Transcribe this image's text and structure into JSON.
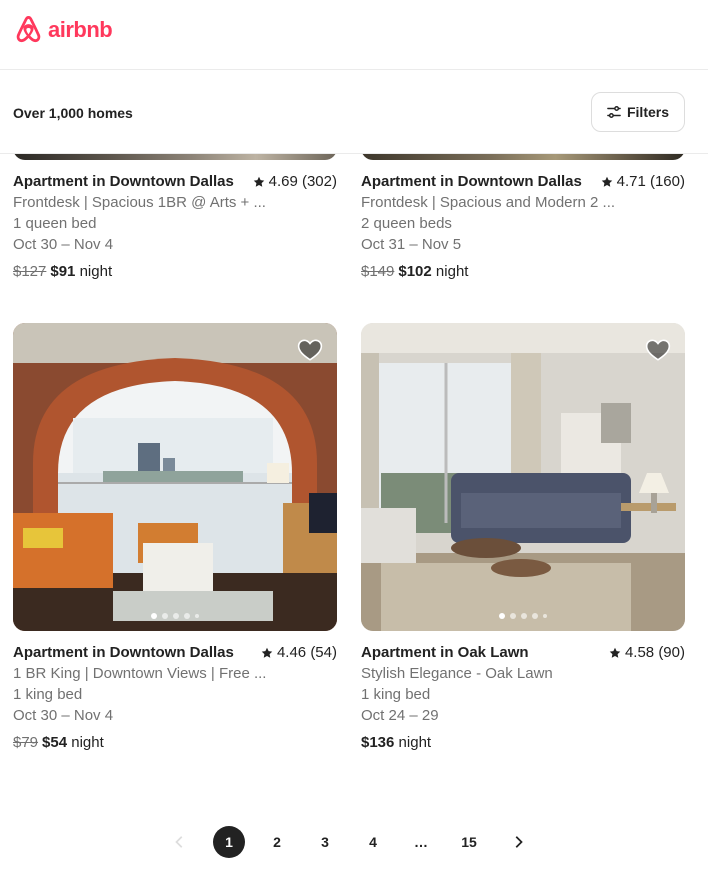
{
  "brand": {
    "name": "airbnb",
    "color": "#ff385c",
    "logo_icon": "airbnb-belo-icon"
  },
  "results": {
    "count_label": "Over 1,000 homes"
  },
  "filters": {
    "label": "Filters",
    "icon": "sliders-icon"
  },
  "listings": [
    {
      "title": "Apartment in Downtown Dallas",
      "rating": "4.69 (302)",
      "description": "Frontdesk | Spacious 1BR @ Arts + ...",
      "beds": "1 queen bed",
      "dates": "Oct 30 – Nov 4",
      "original_price": "$127",
      "price": "$91",
      "price_unit": "night"
    },
    {
      "title": "Apartment in Downtown Dallas",
      "rating": "4.71 (160)",
      "description": "Frontdesk | Spacious and Modern 2 ...",
      "beds": "2 queen beds",
      "dates": "Oct 31 – Nov 5",
      "original_price": "$149",
      "price": "$102",
      "price_unit": "night"
    },
    {
      "title": "Apartment in Downtown Dallas",
      "rating": "4.46 (54)",
      "description": "1 BR King | Downtown Views | Free ...",
      "beds": "1 king bed",
      "dates": "Oct 30 – Nov 4",
      "original_price": "$79",
      "price": "$54",
      "price_unit": "night"
    },
    {
      "title": "Apartment in Oak Lawn",
      "rating": "4.58 (90)",
      "description": "Stylish Elegance - Oak Lawn",
      "beds": "1 king bed",
      "dates": "Oct 24 – 29",
      "original_price": "",
      "price": "$136",
      "price_unit": "night"
    }
  ],
  "pagination": {
    "pages": [
      "1",
      "2",
      "3",
      "4",
      "…",
      "15"
    ],
    "current": "1",
    "prev_icon": "chevron-left-icon",
    "next_icon": "chevron-right-icon"
  }
}
